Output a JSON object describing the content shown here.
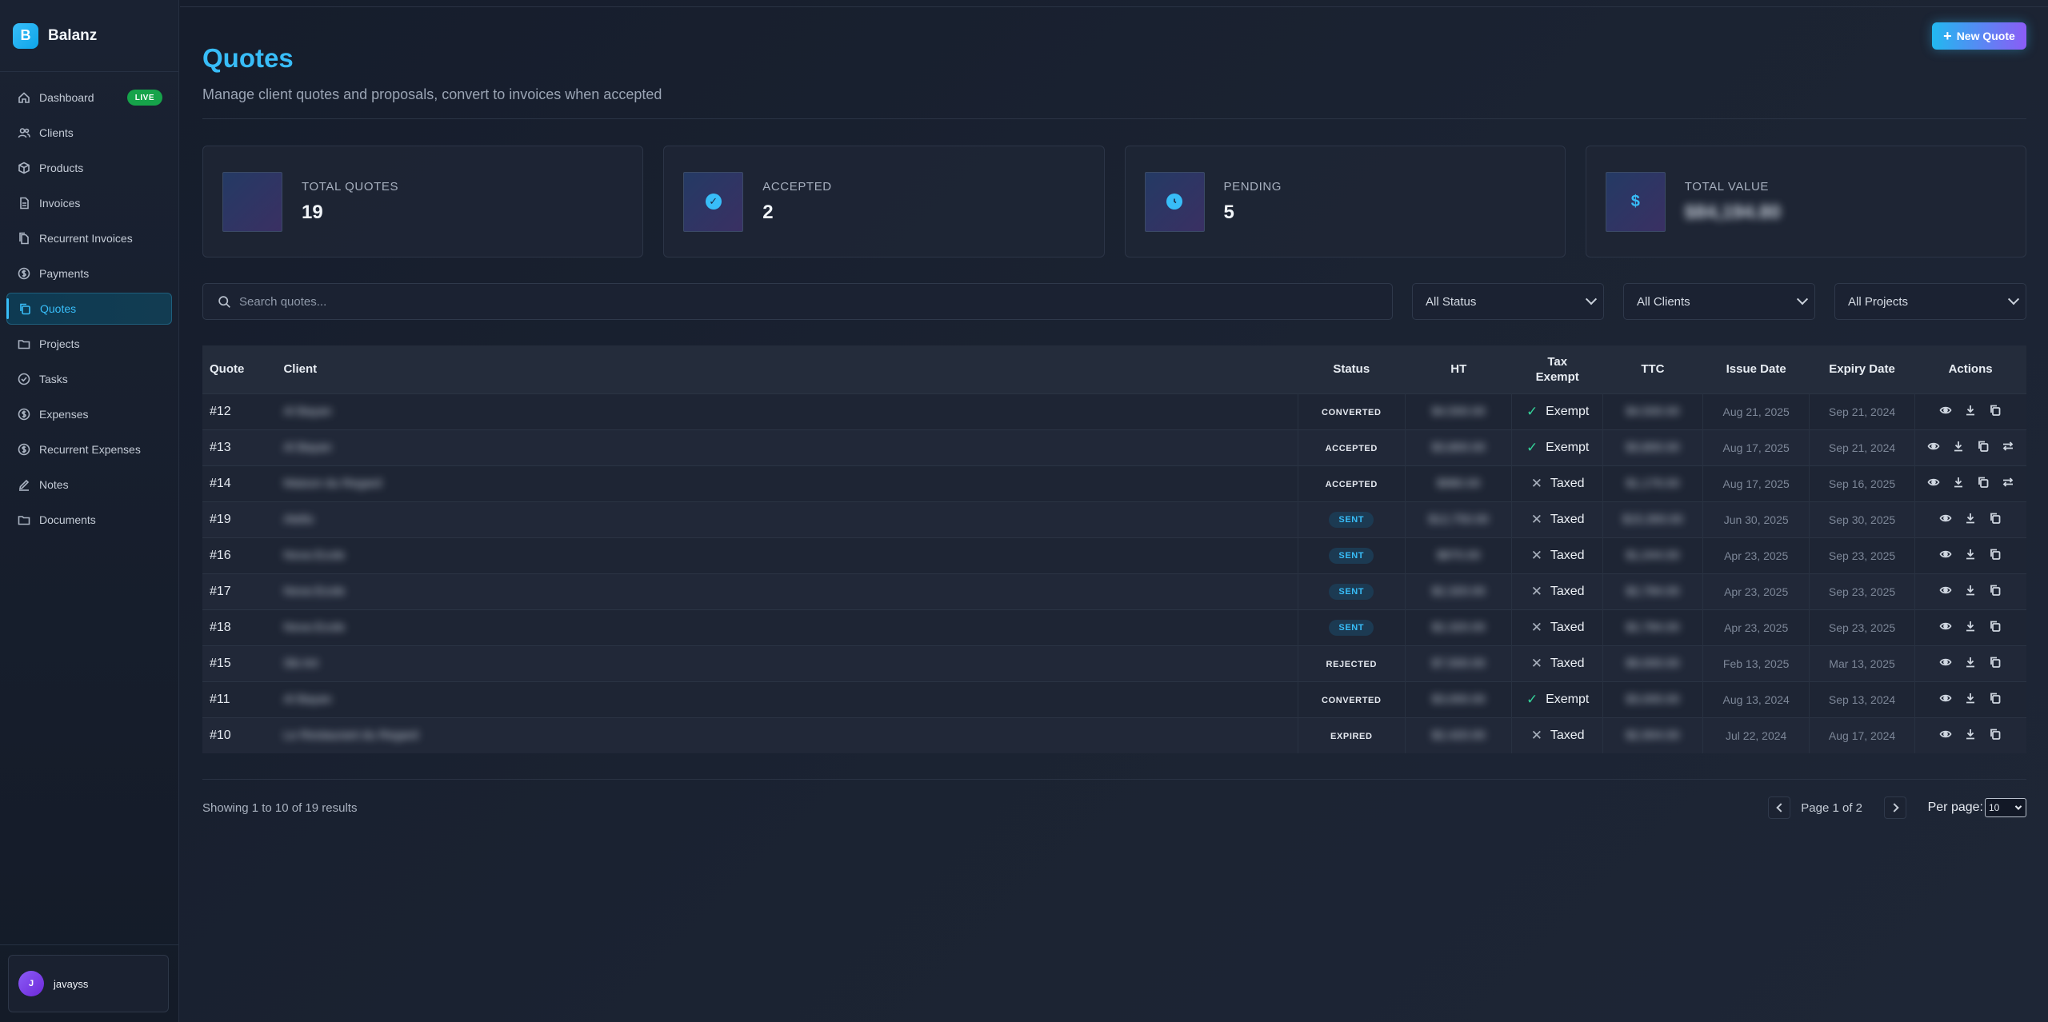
{
  "app": {
    "logo_letter": "B",
    "name": "Balanz"
  },
  "sidebar": {
    "items": [
      {
        "label": "Dashboard",
        "icon": "home-icon",
        "badge": "LIVE"
      },
      {
        "label": "Clients",
        "icon": "users-icon"
      },
      {
        "label": "Products",
        "icon": "box-icon"
      },
      {
        "label": "Invoices",
        "icon": "file-icon"
      },
      {
        "label": "Recurrent Invoices",
        "icon": "files-icon"
      },
      {
        "label": "Payments",
        "icon": "dollar-circle-icon"
      },
      {
        "label": "Quotes",
        "icon": "copy-icon",
        "active": true
      },
      {
        "label": "Projects",
        "icon": "folder-icon"
      },
      {
        "label": "Tasks",
        "icon": "check-circle-icon"
      },
      {
        "label": "Expenses",
        "icon": "dollar-circle-icon"
      },
      {
        "label": "Recurrent Expenses",
        "icon": "dollar-circle-icon"
      },
      {
        "label": "Notes",
        "icon": "pencil-icon"
      },
      {
        "label": "Documents",
        "icon": "folder-icon"
      }
    ],
    "user": {
      "initial": "J",
      "name": "javayss"
    }
  },
  "header": {
    "title": "Quotes",
    "subtitle": "Manage client quotes and proposals, convert to invoices when accepted",
    "new_button": "New Quote"
  },
  "stats": [
    {
      "label": "TOTAL QUOTES",
      "value": "19",
      "icon": "document-icon"
    },
    {
      "label": "ACCEPTED",
      "value": "2",
      "icon": "check-circle-icon"
    },
    {
      "label": "PENDING",
      "value": "5",
      "icon": "clock-icon"
    },
    {
      "label": "TOTAL VALUE",
      "value": "$84,194.80",
      "icon": "dollar-icon",
      "blurred": true
    }
  ],
  "filters": {
    "search_placeholder": "Search quotes...",
    "status": "All Status",
    "clients": "All Clients",
    "projects": "All Projects"
  },
  "table": {
    "headers": [
      "Quote",
      "Client",
      "Status",
      "HT",
      "Tax Exempt",
      "TTC",
      "Issue Date",
      "Expiry Date",
      "Actions"
    ],
    "rows": [
      {
        "quote": "#12",
        "client": "Al Bayan",
        "status": "CONVERTED",
        "ht": "$4,500.00",
        "tax": "Exempt",
        "ttc": "$4,500.00",
        "issue": "Aug 21, 2025",
        "expiry": "Sep 21, 2024",
        "convert": false
      },
      {
        "quote": "#13",
        "client": "Al Bayan",
        "status": "ACCEPTED",
        "ht": "$3,800.00",
        "tax": "Exempt",
        "ttc": "$3,800.00",
        "issue": "Aug 17, 2025",
        "expiry": "Sep 21, 2024",
        "convert": true
      },
      {
        "quote": "#14",
        "client": "Maison du Regard",
        "status": "ACCEPTED",
        "ht": "$980.00",
        "tax": "Taxed",
        "ttc": "$1,176.00",
        "issue": "Aug 17, 2025",
        "expiry": "Sep 16, 2025",
        "convert": true
      },
      {
        "quote": "#19",
        "client": "Atelio",
        "status": "SENT",
        "ht": "$12,750.00",
        "tax": "Taxed",
        "ttc": "$15,300.00",
        "issue": "Jun 30, 2025",
        "expiry": "Sep 30, 2025",
        "convert": false
      },
      {
        "quote": "#16",
        "client": "Nova Ecole",
        "status": "SENT",
        "ht": "$870.00",
        "tax": "Taxed",
        "ttc": "$1,044.00",
        "issue": "Apr 23, 2025",
        "expiry": "Sep 23, 2025",
        "convert": false
      },
      {
        "quote": "#17",
        "client": "Nova Ecole",
        "status": "SENT",
        "ht": "$2,320.00",
        "tax": "Taxed",
        "ttc": "$2,784.00",
        "issue": "Apr 23, 2025",
        "expiry": "Sep 23, 2025",
        "convert": false
      },
      {
        "quote": "#18",
        "client": "Nova Ecole",
        "status": "SENT",
        "ht": "$2,320.00",
        "tax": "Taxed",
        "ttc": "$2,784.00",
        "issue": "Apr 23, 2025",
        "expiry": "Sep 23, 2025",
        "convert": false
      },
      {
        "quote": "#15",
        "client": "Ski Art",
        "status": "REJECTED",
        "ht": "$7,500.00",
        "tax": "Taxed",
        "ttc": "$9,000.00",
        "issue": "Feb 13, 2025",
        "expiry": "Mar 13, 2025",
        "convert": false
      },
      {
        "quote": "#11",
        "client": "Al Bayan",
        "status": "CONVERTED",
        "ht": "$3,000.00",
        "tax": "Exempt",
        "ttc": "$3,000.00",
        "issue": "Aug 13, 2024",
        "expiry": "Sep 13, 2024",
        "convert": false
      },
      {
        "quote": "#10",
        "client": "Le Restaurant du Regard",
        "status": "EXPIRED",
        "ht": "$2,420.00",
        "tax": "Taxed",
        "ttc": "$2,904.00",
        "issue": "Jul 22, 2024",
        "expiry": "Aug 17, 2024",
        "convert": false
      }
    ]
  },
  "pagination": {
    "showing": "Showing 1 to 10 of 19 results",
    "page_info": "Page 1 of 2",
    "per_page_label": "Per page:",
    "per_page_value": "10"
  }
}
